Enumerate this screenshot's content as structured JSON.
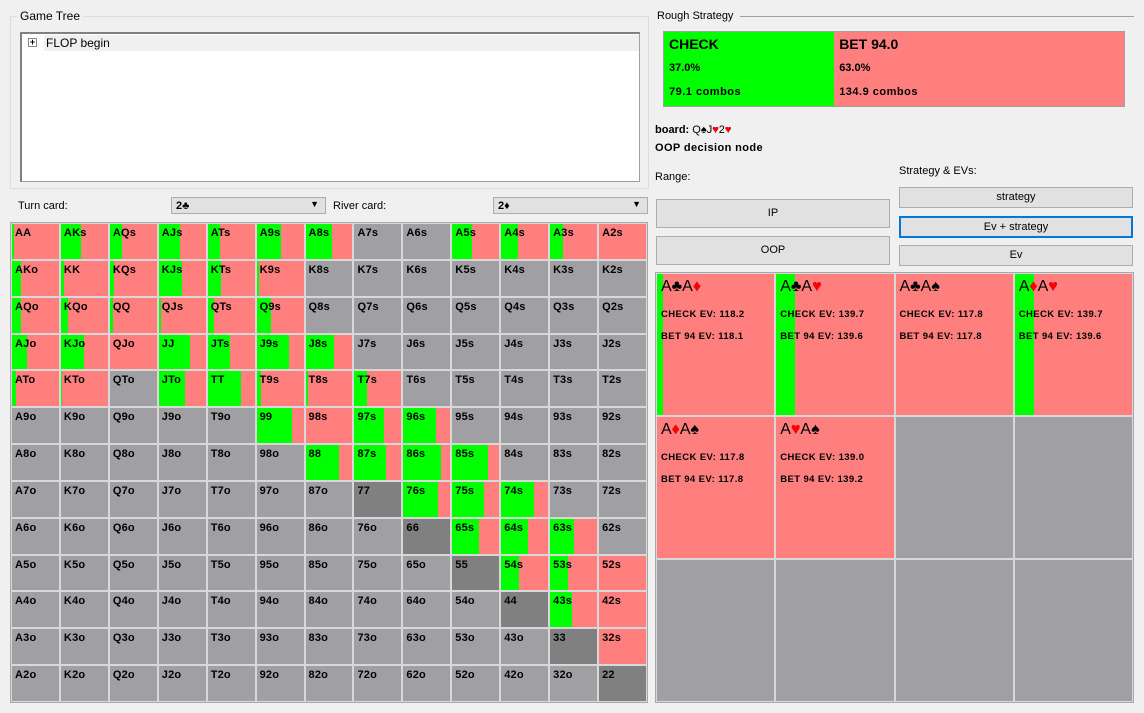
{
  "game_tree": {
    "title": "Game Tree",
    "nodes": [
      {
        "label": "FLOP begin",
        "expander": "+"
      }
    ]
  },
  "turn": {
    "label": "Turn card:",
    "value": "2♣"
  },
  "river": {
    "label": "River card:",
    "value": "2♦"
  },
  "colors": {
    "check": "#00ff00",
    "bet": "#ff7f7f",
    "not_in_range": "#a0a0a4",
    "blocked": "#808080"
  },
  "hand_matrix": {
    "labels": [
      [
        "AA",
        "AKs",
        "AQs",
        "AJs",
        "ATs",
        "A9s",
        "A8s",
        "A7s",
        "A6s",
        "A5s",
        "A4s",
        "A3s",
        "A2s"
      ],
      [
        "AKo",
        "KK",
        "KQs",
        "KJs",
        "KTs",
        "K9s",
        "K8s",
        "K7s",
        "K6s",
        "K5s",
        "K4s",
        "K3s",
        "K2s"
      ],
      [
        "AQo",
        "KQo",
        "QQ",
        "QJs",
        "QTs",
        "Q9s",
        "Q8s",
        "Q7s",
        "Q6s",
        "Q5s",
        "Q4s",
        "Q3s",
        "Q2s"
      ],
      [
        "AJo",
        "KJo",
        "QJo",
        "JJ",
        "JTs",
        "J9s",
        "J8s",
        "J7s",
        "J6s",
        "J5s",
        "J4s",
        "J3s",
        "J2s"
      ],
      [
        "ATo",
        "KTo",
        "QTo",
        "JTo",
        "TT",
        "T9s",
        "T8s",
        "T7s",
        "T6s",
        "T5s",
        "T4s",
        "T3s",
        "T2s"
      ],
      [
        "A9o",
        "K9o",
        "Q9o",
        "J9o",
        "T9o",
        "99",
        "98s",
        "97s",
        "96s",
        "95s",
        "94s",
        "93s",
        "92s"
      ],
      [
        "A8o",
        "K8o",
        "Q8o",
        "J8o",
        "T8o",
        "98o",
        "88",
        "87s",
        "86s",
        "85s",
        "84s",
        "83s",
        "82s"
      ],
      [
        "A7o",
        "K7o",
        "Q7o",
        "J7o",
        "T7o",
        "97o",
        "87o",
        "77",
        "76s",
        "75s",
        "74s",
        "73s",
        "72s"
      ],
      [
        "A6o",
        "K6o",
        "Q6o",
        "J6o",
        "T6o",
        "96o",
        "86o",
        "76o",
        "66",
        "65s",
        "64s",
        "63s",
        "62s"
      ],
      [
        "A5o",
        "K5o",
        "Q5o",
        "J5o",
        "T5o",
        "95o",
        "85o",
        "75o",
        "65o",
        "55",
        "54s",
        "53s",
        "52s"
      ],
      [
        "A4o",
        "K4o",
        "Q4o",
        "J4o",
        "T4o",
        "94o",
        "84o",
        "74o",
        "64o",
        "54o",
        "44",
        "43s",
        "42s"
      ],
      [
        "A3o",
        "K3o",
        "Q3o",
        "J3o",
        "T3o",
        "93o",
        "83o",
        "73o",
        "63o",
        "53o",
        "43o",
        "33",
        "32s"
      ],
      [
        "A2o",
        "K2o",
        "Q2o",
        "J2o",
        "T2o",
        "92o",
        "82o",
        "72o",
        "62o",
        "52o",
        "42o",
        "32o",
        "22"
      ]
    ],
    "check_freq": [
      [
        0.04,
        0.42,
        0.26,
        0.45,
        0.26,
        0.53,
        0.56,
        null,
        null,
        0.41,
        0.36,
        0.27,
        0
      ],
      [
        0.19,
        0.06,
        0.08,
        0.5,
        0.29,
        0.05,
        null,
        null,
        null,
        null,
        null,
        null,
        null
      ],
      [
        0.2,
        0.16,
        0.07,
        0.04,
        0.14,
        0.31,
        null,
        null,
        null,
        null,
        null,
        null,
        null
      ],
      [
        0.33,
        0.5,
        0,
        0.67,
        0.48,
        0.7,
        0.6,
        null,
        null,
        null,
        null,
        null,
        null
      ],
      [
        0.08,
        0.03,
        null,
        0.56,
        0.7,
        0.1,
        0.05,
        0.27,
        null,
        null,
        null,
        null,
        null
      ],
      [
        null,
        null,
        null,
        null,
        null,
        0.75,
        0,
        0.62,
        0.7,
        null,
        null,
        null,
        null
      ],
      [
        null,
        null,
        null,
        null,
        null,
        null,
        0.72,
        0.68,
        0.8,
        0.77,
        null,
        null,
        null
      ],
      [
        null,
        null,
        null,
        null,
        null,
        null,
        null,
        "blocked",
        0.73,
        0.67,
        0.7,
        null,
        null
      ],
      [
        null,
        null,
        null,
        null,
        null,
        null,
        null,
        null,
        "blocked",
        0.56,
        0.58,
        0.51,
        null
      ],
      [
        null,
        null,
        null,
        null,
        null,
        null,
        null,
        null,
        null,
        "blocked",
        0.38,
        0.39,
        0
      ],
      [
        null,
        null,
        null,
        null,
        null,
        null,
        null,
        null,
        null,
        null,
        "blocked",
        0.46,
        0
      ],
      [
        null,
        null,
        null,
        null,
        null,
        null,
        null,
        null,
        null,
        null,
        null,
        "blocked",
        0
      ],
      [
        null,
        null,
        null,
        null,
        null,
        null,
        null,
        null,
        null,
        null,
        null,
        null,
        "blocked"
      ]
    ]
  },
  "rough_strategy": {
    "title": "Rough Strategy",
    "actions": [
      {
        "name": "CHECK",
        "percent": "37.0%",
        "combos": "79.1 combos",
        "freq": 0.37
      },
      {
        "name": "BET 94.0",
        "percent": "63.0%",
        "combos": "134.9 combos",
        "freq": 0.63
      }
    ]
  },
  "board": {
    "label": "board:",
    "cards": "Q♠J♥2♥"
  },
  "node_label": "OOP decision node",
  "range": {
    "label": "Range:",
    "buttons": [
      "IP",
      "OOP"
    ]
  },
  "strategy_evs": {
    "label": "Strategy & EVs:",
    "buttons": [
      "strategy",
      "Ev + strategy",
      "Ev"
    ],
    "selected": "Ev + strategy"
  },
  "combos": [
    {
      "cards": "A♣A♦",
      "check_ev": "CHECK EV: 118.2",
      "bet_ev": "BET 94 EV: 118.1",
      "check_freq": 0.05
    },
    {
      "cards": "A♣A♥",
      "check_ev": "CHECK EV: 139.7",
      "bet_ev": "BET 94 EV: 139.6",
      "check_freq": 0.16
    },
    {
      "cards": "A♣A♠",
      "check_ev": "CHECK EV: 117.8",
      "bet_ev": "BET 94 EV: 117.8",
      "check_freq": 0
    },
    {
      "cards": "A♦A♥",
      "check_ev": "CHECK EV: 139.7",
      "bet_ev": "BET 94 EV: 139.6",
      "check_freq": 0.16
    },
    {
      "cards": "A♦A♠",
      "check_ev": "CHECK EV: 117.8",
      "bet_ev": "BET 94 EV: 117.8",
      "check_freq": 0
    },
    {
      "cards": "A♥A♠",
      "check_ev": "CHECK EV: 139.0",
      "bet_ev": "BET 94 EV: 139.2",
      "check_freq": 0
    }
  ]
}
